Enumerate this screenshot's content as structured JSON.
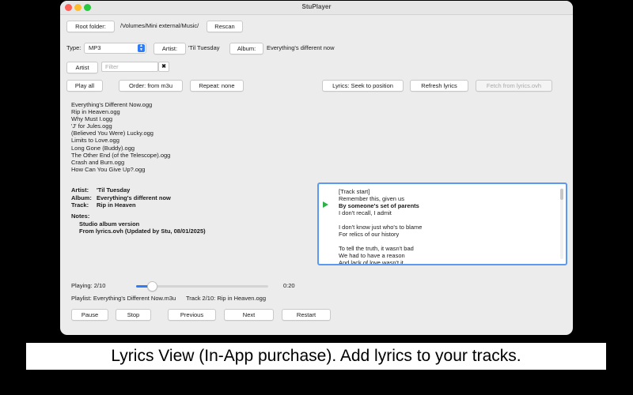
{
  "window": {
    "title": "StuPlayer"
  },
  "top": {
    "root_folder_label": "Root folder:",
    "root_path": "/Volumes/Mini external/Music/",
    "rescan_label": "Rescan"
  },
  "type_row": {
    "type_label": "Type:",
    "type_value": "MP3",
    "artist_button": "Artist:",
    "artist_value": "'Til Tuesday",
    "album_button": "Album:",
    "album_value": "Everything's different now"
  },
  "filter_row": {
    "artist_button": "Artist",
    "filter_placeholder": "Filter",
    "clear_glyph": "✖"
  },
  "controls": {
    "play_all": "Play all",
    "order": "Order: from m3u",
    "repeat": "Repeat: none",
    "lyrics_mode": "Lyrics: Seek to position",
    "refresh_lyrics": "Refresh lyrics",
    "fetch_lyrics": "Fetch from lyrics.ovh"
  },
  "tracks": [
    "Everything's Different Now.ogg",
    "Rip in Heaven.ogg",
    "Why Must I.ogg",
    "'J' for Jules.ogg",
    "(Believed You Were) Lucky.ogg",
    "Limits to Love.ogg",
    "Long Gone (Buddy).ogg",
    "The Other End (of the Telescope).ogg",
    "Crash and Burn.ogg",
    "How Can You Give Up?.ogg"
  ],
  "info": {
    "artist_label": "Artist:",
    "artist": "'Til Tuesday",
    "album_label": "Album:",
    "album": "Everything's different now",
    "track_label": "Track:",
    "track": "Rip in Heaven",
    "notes_label": "Notes:",
    "note1": "Studio album version",
    "note2": "From lyrics.ovh (Updated by Stu, 08/01/2025)"
  },
  "lyrics": [
    "[Track start]",
    "Remember this, given us",
    "By someone's set of parents",
    "I don't recall, I admit",
    "",
    "I don't know just who's to blame",
    "For relics of our history",
    "",
    "To tell the truth, it wasn't bad",
    "We had to have a reason",
    "And lack of love wasn't it"
  ],
  "playback": {
    "playing": "Playing: 2/10",
    "time": "0:20",
    "progress": 0.12,
    "playlist": "Playlist: Everything's Different Now.m3u",
    "track_status": "Track 2/10: Rip in Heaven.ogg"
  },
  "transport": {
    "pause": "Pause",
    "stop": "Stop",
    "previous": "Previous",
    "next": "Next",
    "restart": "Restart"
  },
  "caption": "Lyrics View (In-App purchase). Add lyrics to your tracks.",
  "colors": {
    "accent": "#2f7cf6",
    "play_marker": "#2db24a",
    "lyrics_border": "#5b9af0"
  }
}
